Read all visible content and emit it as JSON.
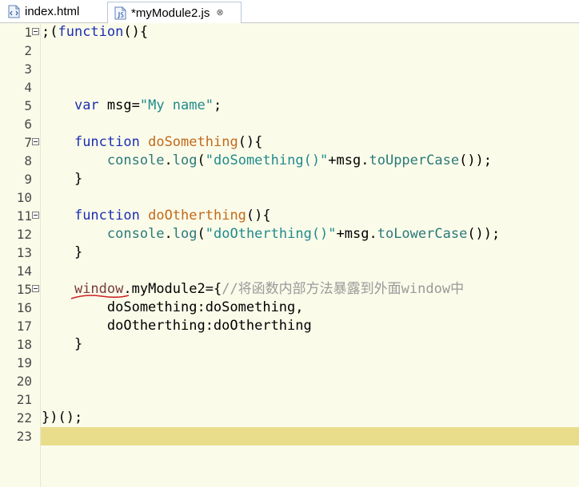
{
  "tabs": [
    {
      "label": "index.html",
      "icon": "html-file-icon",
      "active": false
    },
    {
      "label": "*myModule2.js",
      "icon": "js-file-icon",
      "active": true
    }
  ],
  "close_glyph": "⊗",
  "editor": {
    "current_line": 23,
    "lines": [
      {
        "n": "1",
        "fold": true,
        "parts": [
          {
            "t": ";(",
            "c": "plain"
          },
          {
            "t": "function",
            "c": "kw"
          },
          {
            "t": "(){",
            "c": "plain"
          }
        ]
      },
      {
        "n": "2",
        "parts": []
      },
      {
        "n": "3",
        "parts": []
      },
      {
        "n": "4",
        "parts": []
      },
      {
        "n": "5",
        "parts": [
          {
            "t": "    ",
            "c": "plain"
          },
          {
            "t": "var",
            "c": "kw"
          },
          {
            "t": " msg=",
            "c": "plain"
          },
          {
            "t": "\"My name\"",
            "c": "str"
          },
          {
            "t": ";",
            "c": "plain"
          }
        ]
      },
      {
        "n": "6",
        "parts": []
      },
      {
        "n": "7",
        "fold": true,
        "parts": [
          {
            "t": "    ",
            "c": "plain"
          },
          {
            "t": "function",
            "c": "kw"
          },
          {
            "t": " ",
            "c": "plain"
          },
          {
            "t": "doSomething",
            "c": "fn"
          },
          {
            "t": "(){",
            "c": "plain"
          }
        ]
      },
      {
        "n": "8",
        "parts": [
          {
            "t": "        ",
            "c": "plain"
          },
          {
            "t": "console",
            "c": "prop"
          },
          {
            "t": ".",
            "c": "plain"
          },
          {
            "t": "log",
            "c": "prop"
          },
          {
            "t": "(",
            "c": "plain"
          },
          {
            "t": "\"doSomething()\"",
            "c": "str"
          },
          {
            "t": "+msg.",
            "c": "plain"
          },
          {
            "t": "toUpperCase",
            "c": "prop"
          },
          {
            "t": "());",
            "c": "plain"
          }
        ]
      },
      {
        "n": "9",
        "parts": [
          {
            "t": "    }",
            "c": "plain"
          }
        ]
      },
      {
        "n": "10",
        "parts": []
      },
      {
        "n": "11",
        "fold": true,
        "parts": [
          {
            "t": "    ",
            "c": "plain"
          },
          {
            "t": "function",
            "c": "kw"
          },
          {
            "t": " ",
            "c": "plain"
          },
          {
            "t": "doOtherthing",
            "c": "fn"
          },
          {
            "t": "(){",
            "c": "plain"
          }
        ]
      },
      {
        "n": "12",
        "parts": [
          {
            "t": "        ",
            "c": "plain"
          },
          {
            "t": "console",
            "c": "prop"
          },
          {
            "t": ".",
            "c": "plain"
          },
          {
            "t": "log",
            "c": "prop"
          },
          {
            "t": "(",
            "c": "plain"
          },
          {
            "t": "\"doOtherthing()\"",
            "c": "str"
          },
          {
            "t": "+msg.",
            "c": "plain"
          },
          {
            "t": "toLowerCase",
            "c": "prop"
          },
          {
            "t": "());",
            "c": "plain"
          }
        ]
      },
      {
        "n": "13",
        "parts": [
          {
            "t": "    }",
            "c": "plain"
          }
        ]
      },
      {
        "n": "14",
        "parts": []
      },
      {
        "n": "15",
        "fold": true,
        "parts": [
          {
            "t": "    ",
            "c": "plain"
          },
          {
            "t": "window",
            "c": "glob"
          },
          {
            "t": ".myModule2={",
            "c": "plain"
          },
          {
            "t": "//将函数内部方法暴露到外面window中",
            "c": "cmt"
          }
        ]
      },
      {
        "n": "16",
        "parts": [
          {
            "t": "        doSomething:doSomething,",
            "c": "plain"
          }
        ]
      },
      {
        "n": "17",
        "parts": [
          {
            "t": "        doOtherthing:doOtherthing",
            "c": "plain"
          }
        ]
      },
      {
        "n": "18",
        "parts": [
          {
            "t": "    }",
            "c": "plain"
          }
        ]
      },
      {
        "n": "19",
        "parts": []
      },
      {
        "n": "20",
        "parts": []
      },
      {
        "n": "21",
        "parts": []
      },
      {
        "n": "22",
        "parts": [
          {
            "t": "})();",
            "c": "plain"
          }
        ]
      },
      {
        "n": "23",
        "parts": []
      }
    ]
  },
  "colors": {
    "keyword": "#1c2fb0",
    "string": "#1f8b8b",
    "function_name": "#c26a1a",
    "comment": "#9a9a9a",
    "current_line": "#e9dd8b",
    "background": "#fbfbea",
    "annotation_underline": "#cc2222"
  }
}
